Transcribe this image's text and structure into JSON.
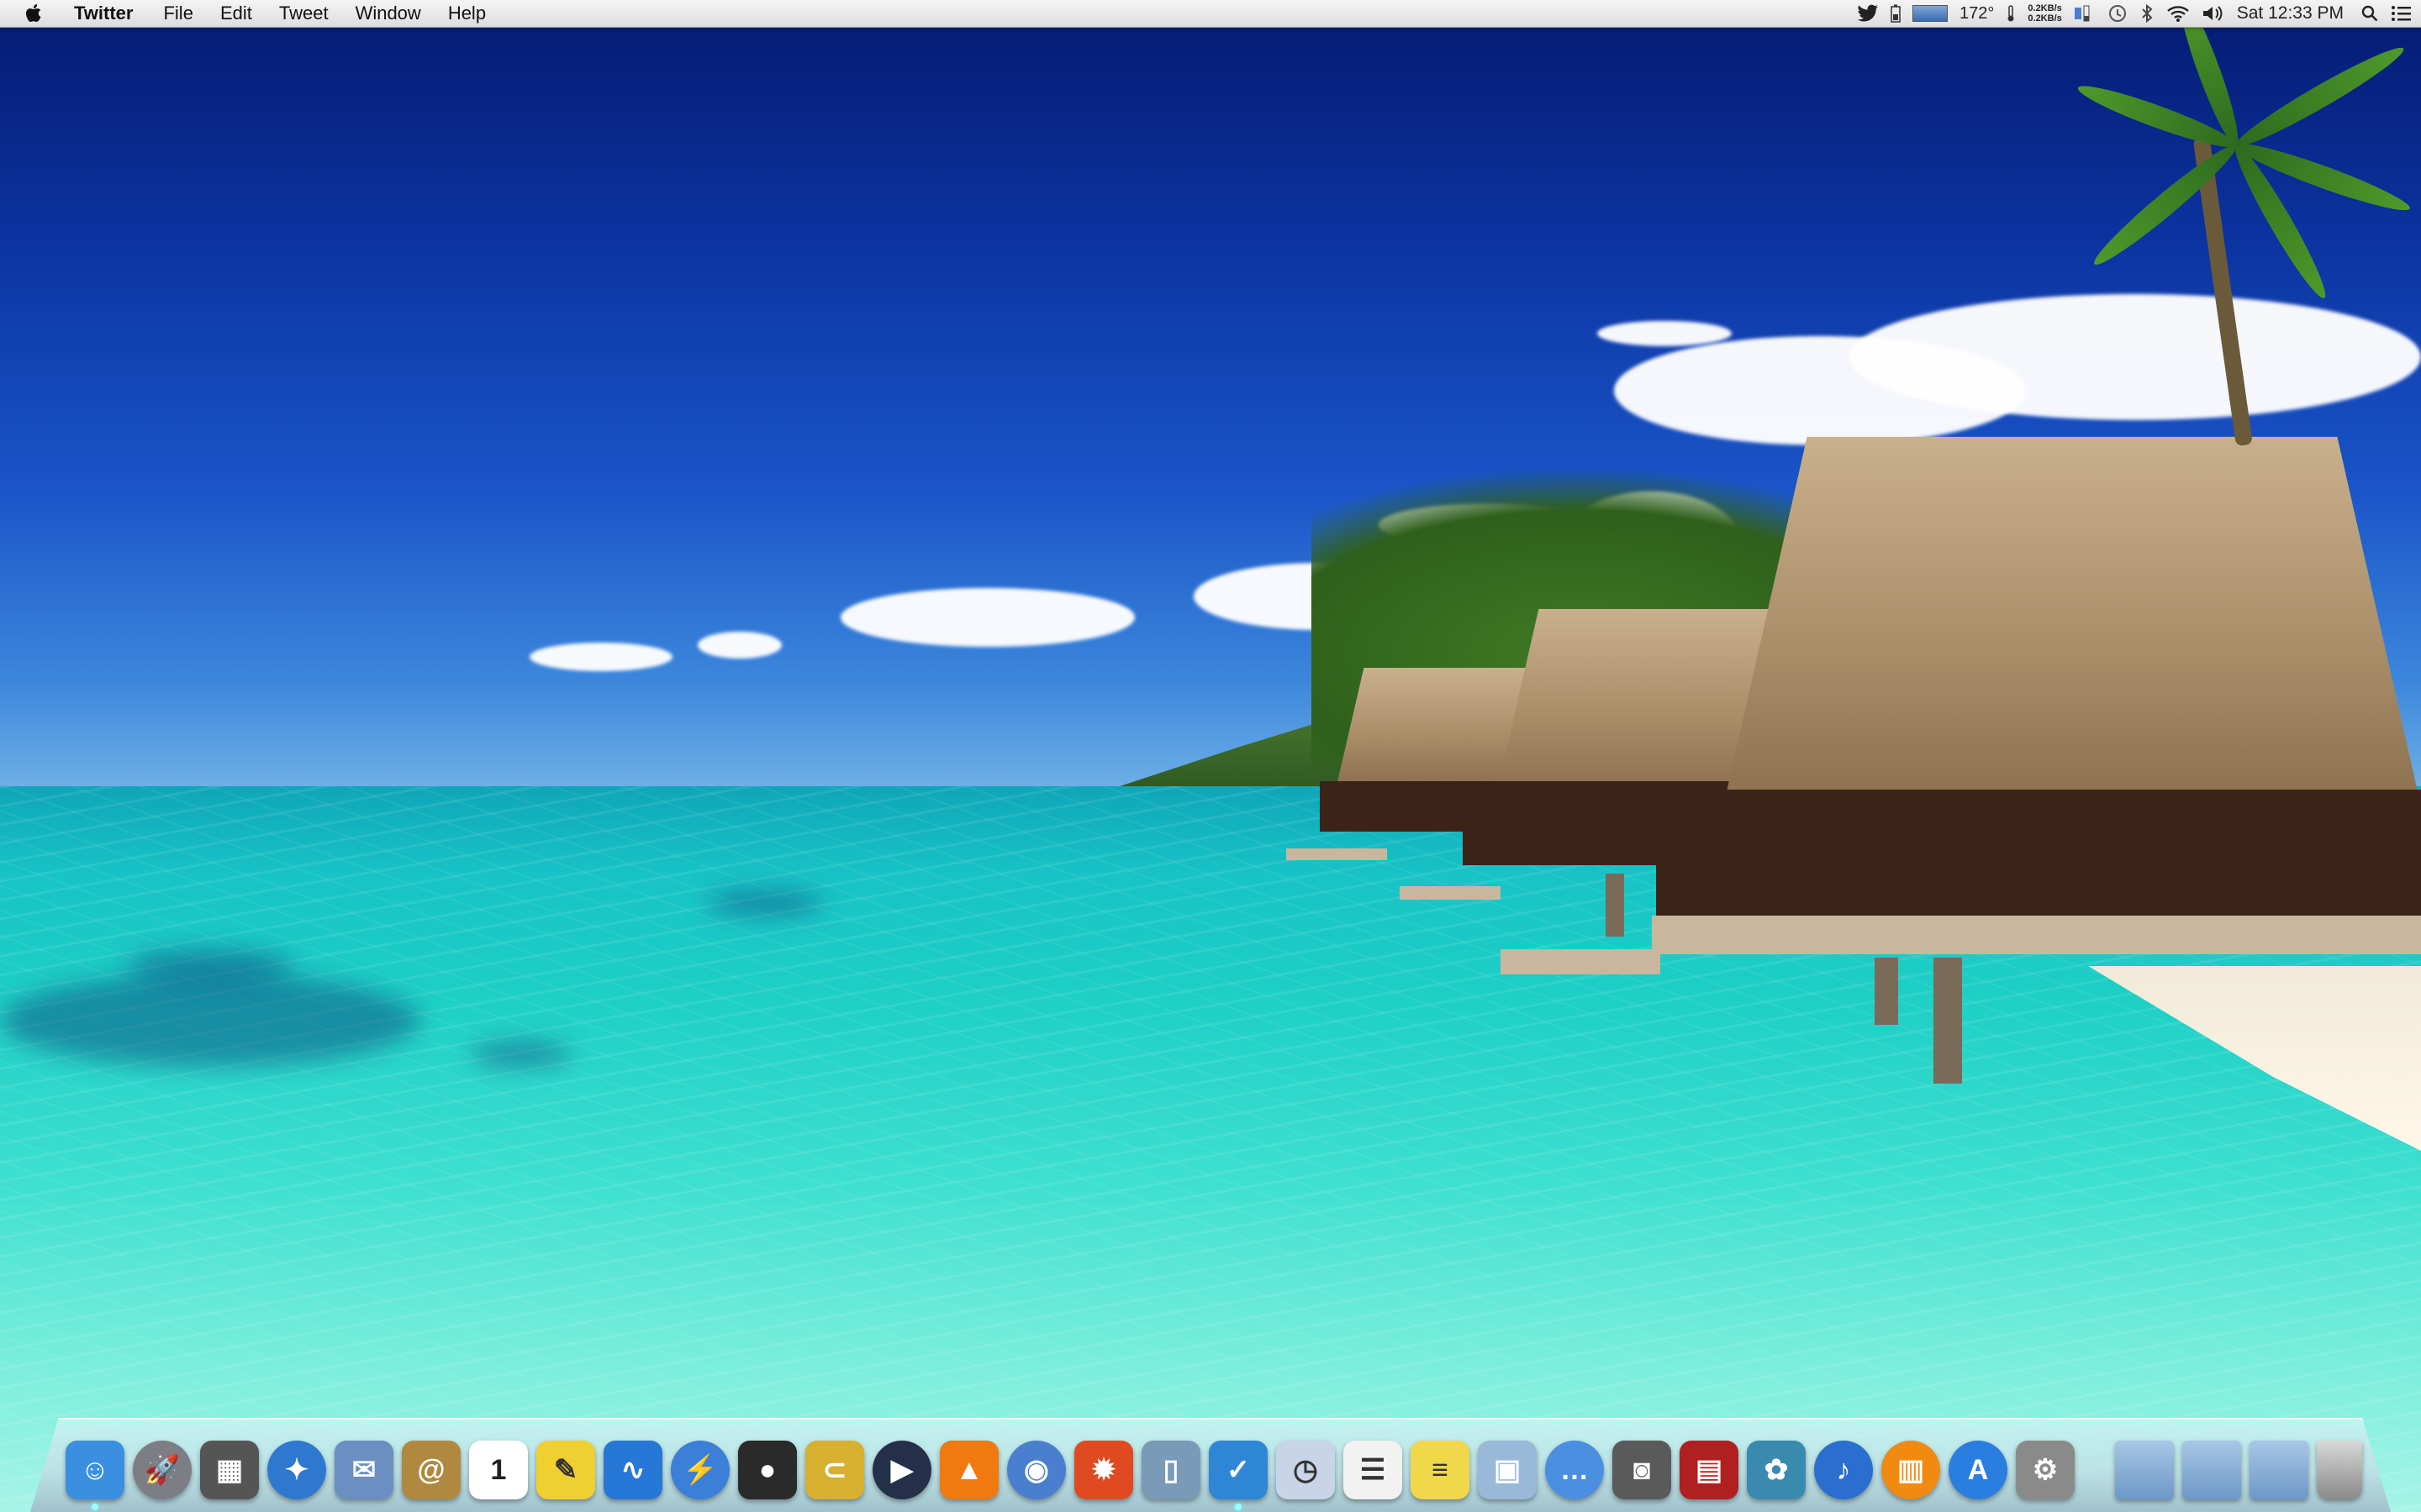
{
  "menubar": {
    "app_name": "Twitter",
    "menus": [
      "File",
      "Edit",
      "Tweet",
      "Window",
      "Help"
    ],
    "status": {
      "temperature": "172°",
      "net_up": "0.2KB/s",
      "net_down": "0.2KB/s",
      "clock": "Sat 12:33 PM"
    },
    "status_icons": [
      "twitter-icon",
      "battery-icon",
      "cpu-graph-icon",
      "temperature-icon",
      "network-icon",
      "battery-level-icon",
      "time-machine-icon",
      "bluetooth-icon",
      "wifi-icon",
      "volume-icon",
      "spotlight-icon",
      "notification-center-icon"
    ]
  },
  "dock": {
    "apps": [
      {
        "name": "finder",
        "icon": "finder-icon",
        "color": "#3a8fe0"
      },
      {
        "name": "launchpad",
        "icon": "rocket-icon",
        "color": "#7d7d86"
      },
      {
        "name": "mission-control",
        "icon": "mission-control-icon",
        "color": "#555"
      },
      {
        "name": "safari",
        "icon": "compass-icon",
        "color": "#2f78d0"
      },
      {
        "name": "mail",
        "icon": "stamp-icon",
        "color": "#6a8fc0"
      },
      {
        "name": "contacts",
        "icon": "address-book-icon",
        "color": "#b08840"
      },
      {
        "name": "calendar",
        "icon": "calendar-icon",
        "color": "#ffffff",
        "text": "1"
      },
      {
        "name": "stickies",
        "icon": "notes-icon",
        "color": "#f0d030"
      },
      {
        "name": "wave-app",
        "icon": "waveform-icon",
        "color": "#2677d6"
      },
      {
        "name": "reeder",
        "icon": "lightning-icon",
        "color": "#3b7fd8"
      },
      {
        "name": "alfred",
        "icon": "bowler-hat-icon",
        "color": "#2a2a2a"
      },
      {
        "name": "clipmenu",
        "icon": "paperclip-icon",
        "color": "#d8b030"
      },
      {
        "name": "quicktime",
        "icon": "play-icon",
        "color": "#24304a"
      },
      {
        "name": "vlc",
        "icon": "traffic-cone-icon",
        "color": "#f07a10"
      },
      {
        "name": "chrome",
        "icon": "chrome-icon",
        "color": "#4a7fd0"
      },
      {
        "name": "burn",
        "icon": "flame-icon",
        "color": "#e04a20"
      },
      {
        "name": "prefs-bottle",
        "icon": "bottle-icon",
        "color": "#7a9ab8"
      },
      {
        "name": "twitter",
        "icon": "twitter-bird-icon",
        "color": "#2f86d6"
      },
      {
        "name": "time-utility",
        "icon": "clock-calendar-icon",
        "color": "#c8d4e8"
      },
      {
        "name": "reminders",
        "icon": "checklist-icon",
        "color": "#f2f2f2"
      },
      {
        "name": "notes",
        "icon": "note-pad-icon",
        "color": "#f1d84a"
      },
      {
        "name": "preview",
        "icon": "preview-icon",
        "color": "#9ab8d8"
      },
      {
        "name": "messages",
        "icon": "speech-bubble-icon",
        "color": "#4a8fe0"
      },
      {
        "name": "facetime",
        "icon": "camera-icon",
        "color": "#5a5a5a"
      },
      {
        "name": "photo-booth",
        "icon": "photo-booth-icon",
        "color": "#b02020"
      },
      {
        "name": "iphoto",
        "icon": "camera-palm-icon",
        "color": "#3a8ab0"
      },
      {
        "name": "itunes",
        "icon": "music-note-icon",
        "color": "#2a6fd0"
      },
      {
        "name": "ibooks",
        "icon": "book-icon",
        "color": "#f08a10"
      },
      {
        "name": "app-store",
        "icon": "app-store-icon",
        "color": "#2a7ee0"
      },
      {
        "name": "system-preferences",
        "icon": "gear-icon",
        "color": "#8a8a8a"
      }
    ],
    "folders": [
      {
        "name": "applications-folder",
        "icon": "applications-folder-icon"
      },
      {
        "name": "documents-folder",
        "icon": "documents-folder-icon"
      },
      {
        "name": "downloads-folder",
        "icon": "downloads-folder-icon"
      }
    ],
    "trash": {
      "name": "trash",
      "icon": "trash-icon"
    }
  }
}
